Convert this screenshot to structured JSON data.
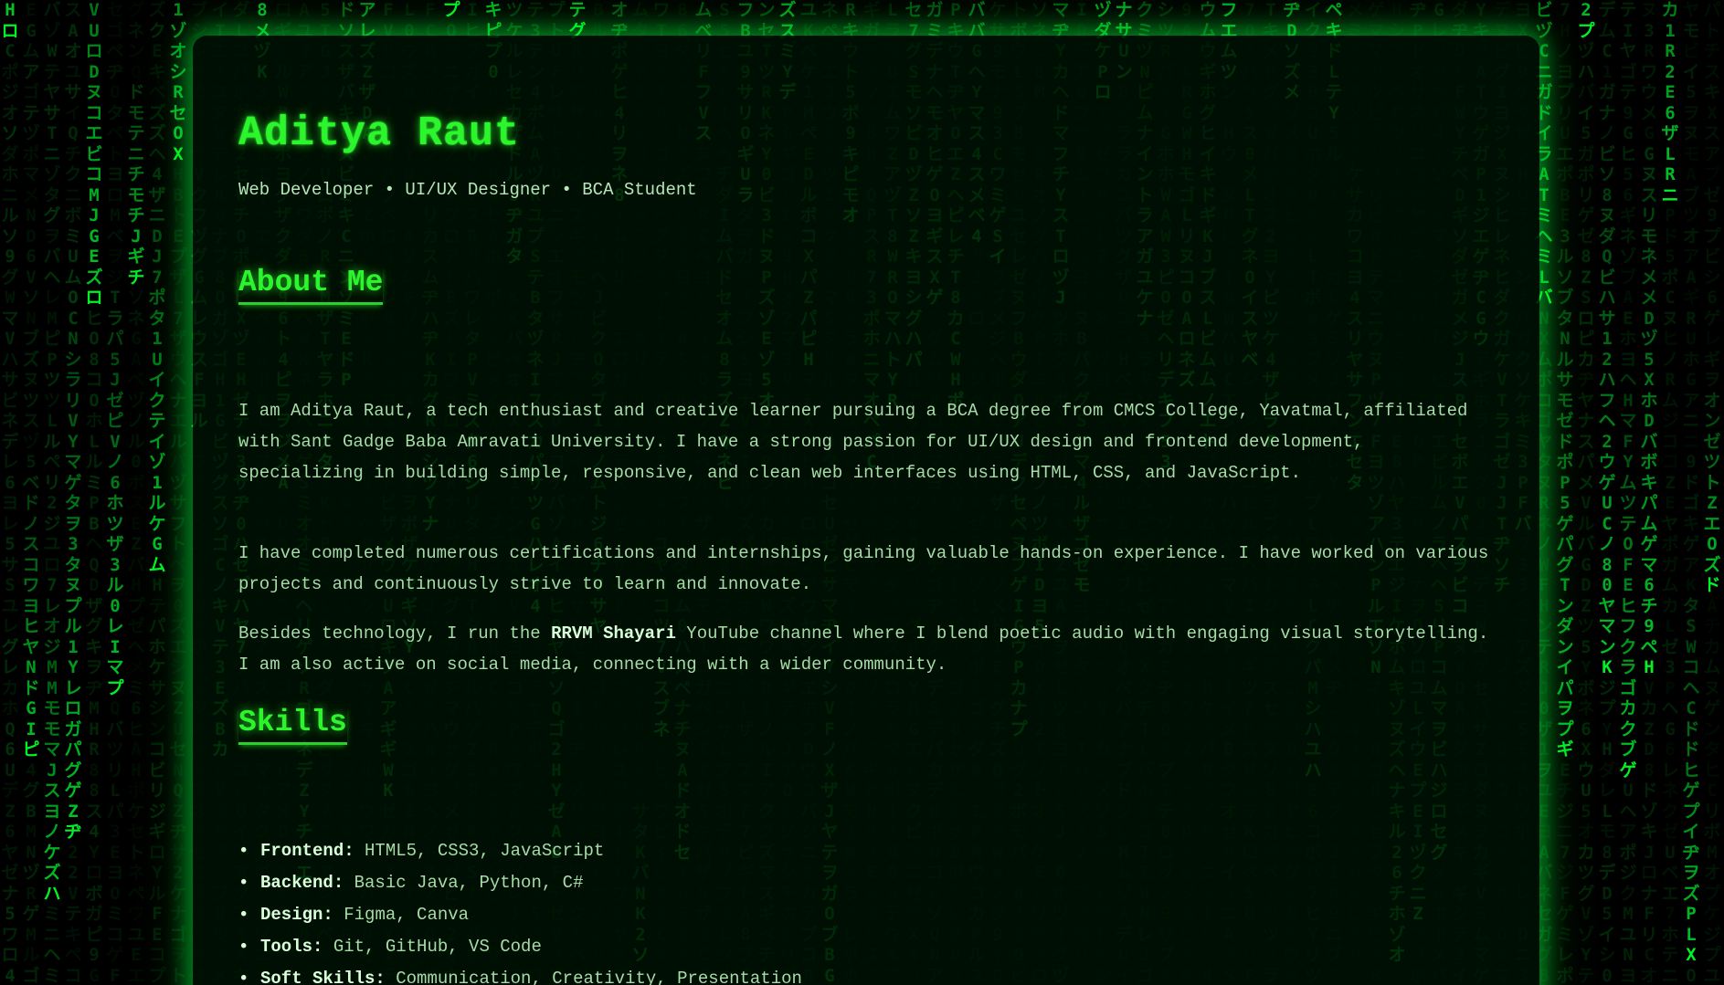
{
  "profile": {
    "name": "Aditya Raut",
    "tagline": "Web Developer • UI/UX Designer • BCA Student"
  },
  "about": {
    "title": "About Me",
    "p1": "I am Aditya Raut, a tech enthusiast and creative learner pursuing a BCA degree from CMCS College, Yavatmal, affiliated with Sant Gadge Baba Amravati University. I have a strong passion for UI/UX design and frontend development, specializing in building simple, responsive, and clean web interfaces using HTML, CSS, and JavaScript.",
    "p2": "I have completed numerous certifications and internships, gaining valuable hands-on experience. I have worked on various projects and continuously strive to learn and innovate.",
    "p3_before": "Besides technology, I run the ",
    "p3_channel": "RRVM Shayari",
    "p3_after": " YouTube channel where I blend poetic audio with engaging visual storytelling. I am also active on social media, connecting with a wider community."
  },
  "skills": {
    "title": "Skills",
    "items": [
      {
        "label": "Frontend:",
        "value": "HTML5, CSS3, JavaScript"
      },
      {
        "label": "Backend:",
        "value": "Basic Java, Python, C#"
      },
      {
        "label": "Design:",
        "value": "Figma, Canva"
      },
      {
        "label": "Tools:",
        "value": "Git, GitHub, VS Code"
      },
      {
        "label": "Soft Skills:",
        "value": "Communication, Creativity, Presentation"
      }
    ]
  },
  "theme": {
    "accent": "#2df52d",
    "background": "#000000",
    "text": "#a6dca6"
  }
}
